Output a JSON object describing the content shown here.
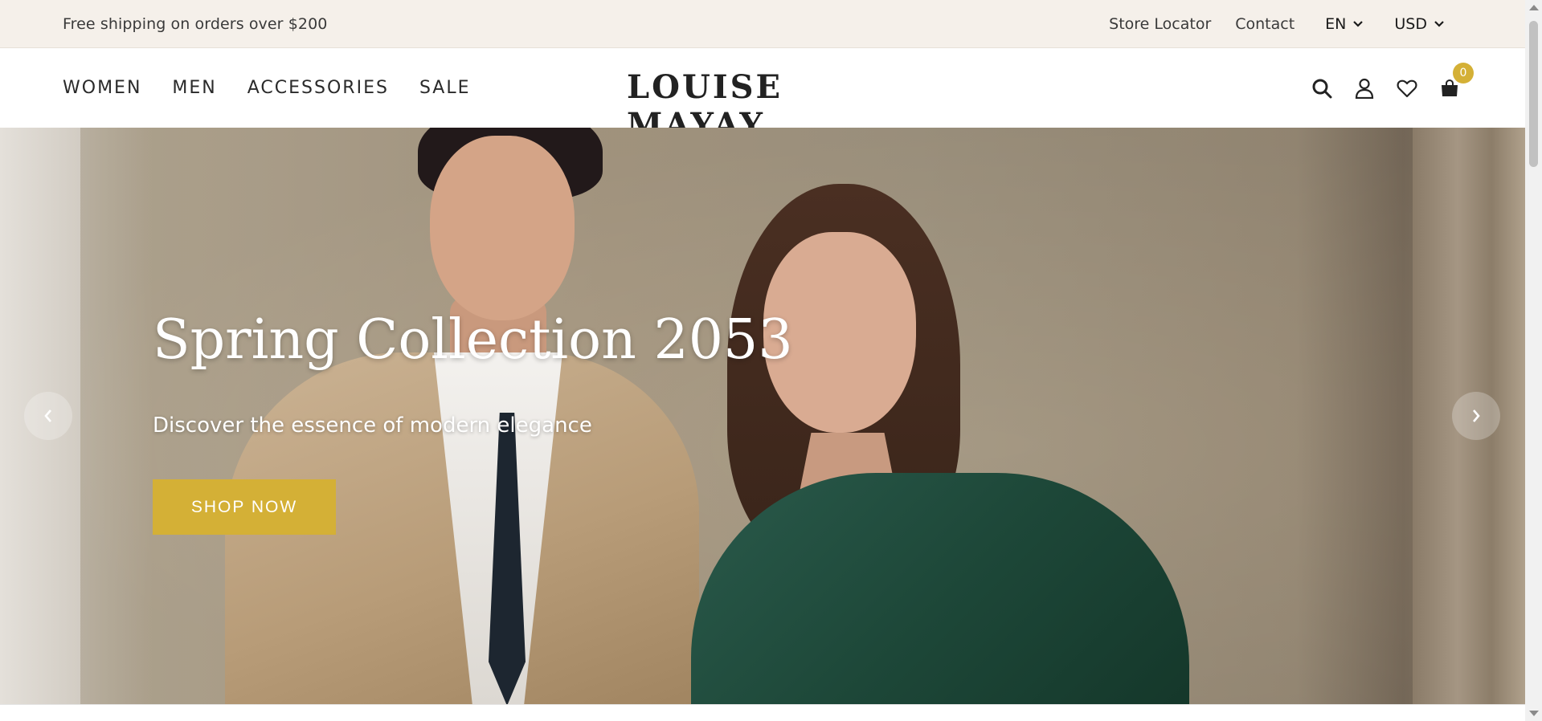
{
  "topbar": {
    "promo": "Free shipping on orders over $200",
    "links": [
      "Store Locator",
      "Contact"
    ],
    "language": "EN",
    "currency": "USD"
  },
  "nav": {
    "menu": [
      "WOMEN",
      "MEN",
      "ACCESSORIES",
      "SALE"
    ],
    "logo": "LOUISE MAYAY",
    "icons": [
      "search-icon",
      "user-icon",
      "heart-icon",
      "bag-icon"
    ],
    "cart_count": "0"
  },
  "hero": {
    "title": "Spring Collection 2053",
    "subtitle": "Discover the essence of modern elegance",
    "cta": "SHOP NOW"
  },
  "colors": {
    "accent": "#d4b036",
    "topbar_bg": "#f5f0ea",
    "text_dark": "#2a2a2a"
  }
}
